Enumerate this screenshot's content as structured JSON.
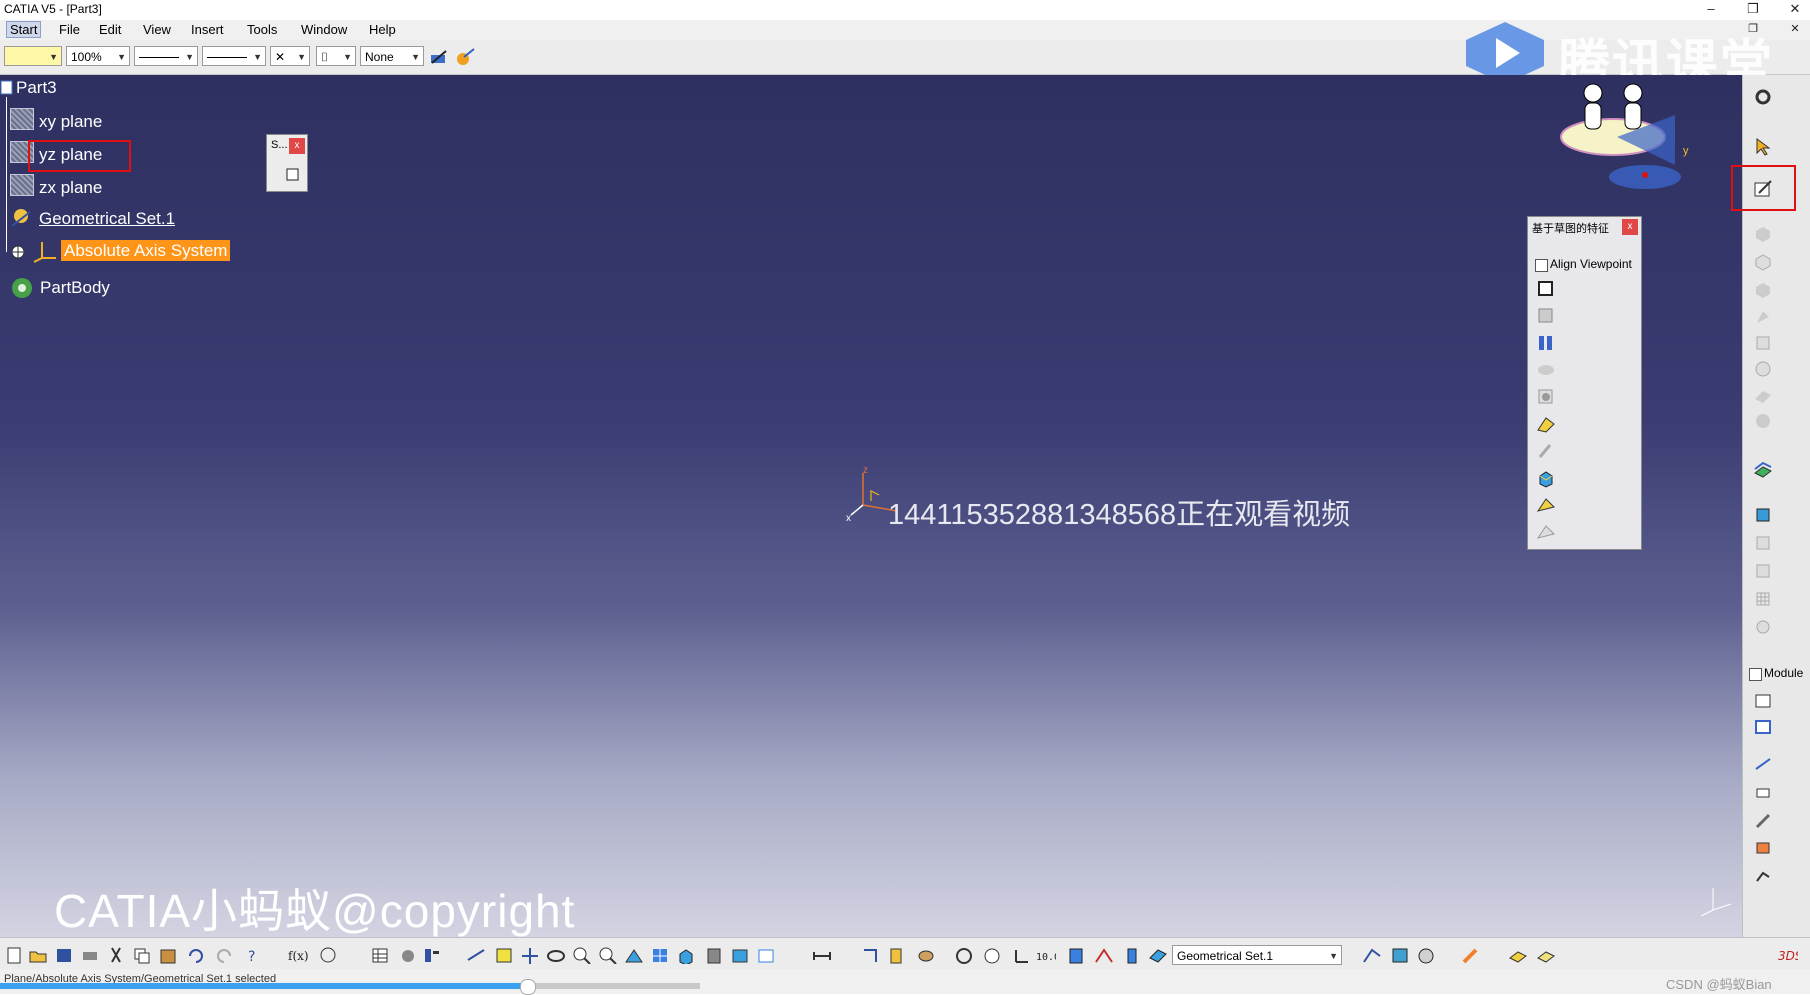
{
  "window": {
    "title": "CATIA V5 - [Part3]",
    "minimize": "–",
    "restore": "❐",
    "close": "✕",
    "doc_restore": "❐",
    "doc_close": "✕"
  },
  "menus": [
    "Start",
    "File",
    "Edit",
    "View",
    "Insert",
    "Tools",
    "Window",
    "Help"
  ],
  "toolbar": {
    "zoom_value": "100%",
    "layer_value": "None",
    "selection_value": "Geometrical Set.1"
  },
  "tree": {
    "root": "Part3",
    "items": [
      "xy plane",
      "yz plane",
      "zx plane",
      "Geometrical Set.1",
      "Absolute Axis System",
      "PartBody"
    ]
  },
  "small_palette": {
    "title": "S...",
    "close": "x"
  },
  "feature_palette": {
    "title": "基于草图的特征",
    "close": "x",
    "align_label": "Align Viewpoint"
  },
  "right_toolbar": {
    "module_label": "Module"
  },
  "viewport": {
    "overlay_text": "1441153528813485​68正在观看视频",
    "copyright": "CATIA小蚂蚁@copyright",
    "axis_x": "x",
    "axis_y": "y",
    "axis_z": "z"
  },
  "watermark": {
    "brand": "腾讯课堂",
    "csdn": "CSDN @蚂蚁Bian"
  },
  "status": {
    "text": "Plane/Absolute Axis System/Geometrical Set.1 selected"
  },
  "colors": {
    "viewport_top": "#2e3060",
    "highlight": "#ff9518",
    "red_marker": "#e01010"
  }
}
